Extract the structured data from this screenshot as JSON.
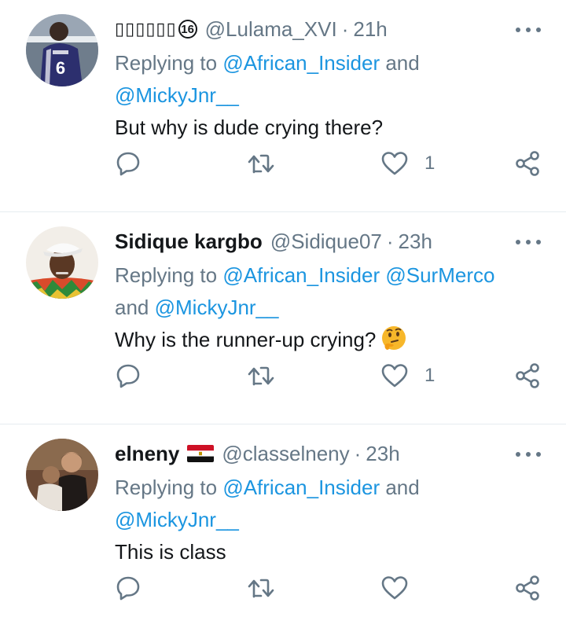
{
  "tweets": [
    {
      "name": "",
      "name_glyphs": "▯▯▯▯▯▯",
      "badge": "16",
      "handle": "@Lulama_XVI",
      "separator": "·",
      "time": "21h",
      "reply_prefix": "Replying to ",
      "reply_mentions": [
        "@African_Insider",
        "@MickyJnr__"
      ],
      "reply_join": " and ",
      "text": "But why is dude crying there?",
      "like_count": "1",
      "avatar_icon": "player-jersey-avatar"
    },
    {
      "name": "Sidique kargbo",
      "handle": "@Sidique07",
      "separator": "·",
      "time": "23h",
      "reply_prefix": "Replying to ",
      "reply_mentions": [
        "@African_Insider",
        "@SurMerco",
        "@MickyJnr__"
      ],
      "reply_join": " and ",
      "text": "Why is the runner-up crying?",
      "emoji": "thinking-face-emoji",
      "like_count": "1",
      "avatar_icon": "man-white-cap-avatar"
    },
    {
      "name": "elneny",
      "flag": "egypt-flag",
      "handle": "@classelneny",
      "separator": "·",
      "time": "23h",
      "reply_prefix": "Replying to ",
      "reply_mentions": [
        "@African_Insider",
        "@MickyJnr__"
      ],
      "reply_join": " and ",
      "text": "This is class",
      "like_count": "",
      "avatar_icon": "two-men-photo-avatar"
    }
  ],
  "colors": {
    "text": "#14171a",
    "secondary": "#657786",
    "link": "#1b95e0",
    "divider": "#e6ecf0"
  },
  "icons": {
    "more": "more-options-icon",
    "reply": "reply-bubble-icon",
    "retweet": "retweet-icon",
    "like": "heart-icon",
    "share": "share-icon"
  }
}
